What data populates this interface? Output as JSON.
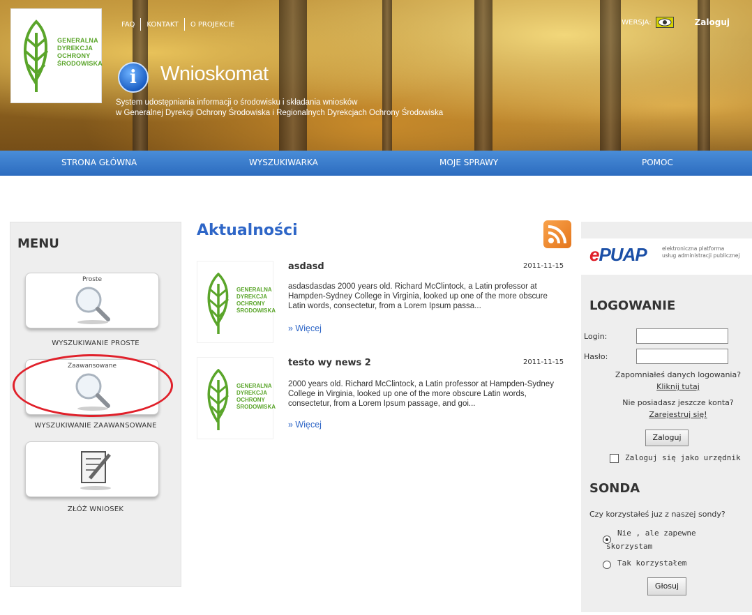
{
  "header": {
    "logo_text": [
      "GENERALNA",
      "DYREKCJA",
      "OCHRONY",
      "ŚRODOWISKA"
    ],
    "top_links": [
      "FAQ",
      "KONTAKT",
      "O PROJEKCIE"
    ],
    "version_label": "WERSJA:",
    "login_link": "Zaloguj",
    "app_title": "Wnioskomat",
    "info_glyph": "i",
    "subtitle_line1": "System udostępniania informacji o środowisku i składania wniosków",
    "subtitle_line2": "w Generalnej Dyrekcji Ochrony Środowiska i Regionalnych Dyrekcjach Ochrony Środowiska"
  },
  "nav": {
    "items": [
      "STRONA GŁÓWNA",
      "WYSZUKIWARKA",
      "MOJE SPRAWY",
      "POMOC"
    ]
  },
  "menu": {
    "title": "MENU",
    "cards": [
      {
        "top_label": "Proste",
        "caption": "WYSZUKIWANIE PROSTE",
        "icon": "magnifier-icon"
      },
      {
        "top_label": "Zaawansowane",
        "caption": "WYSZUKIWANIE ZAAWANSOWANE",
        "icon": "magnifier-icon"
      },
      {
        "top_label": "",
        "caption": "ZŁÓŻ WNIOSEK",
        "icon": "document-pen-icon"
      }
    ]
  },
  "news": {
    "title": "Aktualności",
    "items": [
      {
        "title": "asdasd",
        "date": "2011-11-15",
        "body": "asdasdasdas 2000 years old. Richard McClintock, a Latin professor at Hampden-Sydney College in Virginia, looked up one of the more obscure Latin words, consectetur, from a Lorem Ipsum passa...",
        "more": "» Więcej"
      },
      {
        "title": "testo wy news 2",
        "date": "2011-11-15",
        "body": " 2000 years old. Richard McClintock, a Latin professor at Hampden-Sydney College in Virginia, looked up one of the more obscure Latin words, consectetur, from a Lorem Ipsum passage, and goi...",
        "more": "» Więcej"
      }
    ]
  },
  "epuap": {
    "logo": "ePUAP",
    "desc_line1": "elektroniczna platforma",
    "desc_line2": "usług administracji publicznej"
  },
  "login": {
    "title": "LOGOWANIE",
    "login_label": "Login:",
    "password_label": "Hasło:",
    "login_value": "",
    "password_value": "",
    "forgot_text": "Zapomniałeś danych logowania?",
    "forgot_link": "Kliknij tutaj",
    "no_account_text": "Nie posiadasz jeszcze konta?",
    "register_link": "Zarejestruj się!",
    "submit": "Zaloguj",
    "official_checkbox": "Zaloguj się jako urzędnik"
  },
  "poll": {
    "title": "SONDA",
    "question": "Czy korzystałeś juz z naszej sondy?",
    "option1_line1": "Nie , ale zapewne",
    "option1_line2": "skorzystam",
    "option2": "Tak korzystałem",
    "selected": 1,
    "vote_button": "Głosuj"
  },
  "colors": {
    "accent_blue": "#2e66c7",
    "nav_blue": "#3a7ccc",
    "logo_green": "#5aa52a",
    "annotation_red": "#e0202a"
  }
}
